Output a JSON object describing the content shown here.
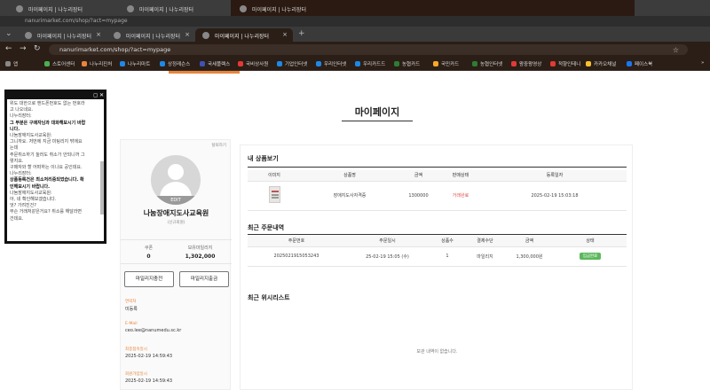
{
  "back_window": {
    "tabs": [
      "마이페이지 | 나누리장터",
      "마이페이지 | 나누리장터",
      "마이페이지 | 나누리장터"
    ],
    "url": "nanurimarket.com/shop/?act=mypage"
  },
  "browser": {
    "tabs": [
      {
        "label": "마이페이지 | 나누리장터"
      },
      {
        "label": "마이페이지 | 나누리장터"
      },
      {
        "label": "마이페이지 | 나누리장터"
      }
    ],
    "url": "nanurimarket.com/shop/?act=mypage",
    "bookmarks": [
      {
        "label": "앱",
        "color": "#888"
      },
      {
        "label": "스토어센터",
        "color": "#4caf50"
      },
      {
        "label": "나누리진처",
        "color": "#e8853c"
      },
      {
        "label": "나누리마트",
        "color": "#1e88e5"
      },
      {
        "label": "상정레슨스",
        "color": "#1e88e5"
      },
      {
        "label": "국세플렉스",
        "color": "#3f51b5"
      },
      {
        "label": "국비상사원",
        "color": "#e53935"
      },
      {
        "label": "기업인터넷",
        "color": "#1e88e5"
      },
      {
        "label": "우리인터넷",
        "color": "#1e88e5"
      },
      {
        "label": "우리카드드",
        "color": "#1e88e5"
      },
      {
        "label": "농협카드",
        "color": "#2e7d32"
      },
      {
        "label": "국민카드",
        "color": "#f9a825"
      },
      {
        "label": "농협인터넷",
        "color": "#2e7d32"
      },
      {
        "label": "왕중왕영상",
        "color": "#e53935"
      },
      {
        "label": "적향인테니",
        "color": "#e53935"
      },
      {
        "label": "카카오채널",
        "color": "#fbc02d"
      },
      {
        "label": "페이스북",
        "color": "#1877f2"
      }
    ]
  },
  "page": {
    "title": "마이페이지"
  },
  "popup": {
    "lines": [
      {
        "text": "위도 대한으로 핸드폰번호도 없는 번호라",
        "bold": false
      },
      {
        "text": "고 나오네요.",
        "bold": false
      },
      {
        "text": "나누리장터:",
        "bold": false
      },
      {
        "text": "그 부분은 구매자님과 대화해보시기 바랍",
        "bold": true
      },
      {
        "text": "니다.",
        "bold": true
      },
      {
        "text": "나눔장애지도사교육원:",
        "bold": false
      },
      {
        "text": "그니까요. 저번에 지금 미팅리지 밖에요",
        "bold": false
      },
      {
        "text": "는데",
        "bold": false
      },
      {
        "text": "주문취소하기 눌러도 취소가 안되니까 그",
        "bold": false
      },
      {
        "text": "렇지요.",
        "bold": false
      },
      {
        "text": "구매자와 할 어떠하는 이나요 공인데요.",
        "bold": false
      },
      {
        "text": "나누리장터:",
        "bold": false
      },
      {
        "text": "상품등록건은 최소처리중되었습니다. 확",
        "bold": true
      },
      {
        "text": "인해보시기 바랍니다.",
        "bold": true
      },
      {
        "text": "나눔장애지도사교육원:",
        "bold": false
      },
      {
        "text": "아, 네 확인해보겠습니다.",
        "bold": false
      },
      {
        "text": "엇? 가려진건?",
        "bold": false
      },
      {
        "text": "무슨 거래처같은거요? 취소를 해달라면",
        "bold": false
      },
      {
        "text": "건데요.",
        "bold": false
      }
    ]
  },
  "profile": {
    "top_link": "탈퇴하기",
    "edit_label": "EDIT",
    "name": "나눔장애지도사교육원",
    "grade": "(신규회원)",
    "coupon_label": "쿠폰",
    "coupon_value": "0",
    "mileage_label": "보유마일리지",
    "mileage_value": "1,302,000",
    "btn_charge": "마일리지충전",
    "btn_withdraw": "마일리지출금",
    "fields": [
      {
        "key": "연락처",
        "value": "미등록"
      },
      {
        "key": "E-Mail",
        "value": "ceo.lee@nanumedu.sc.kr"
      },
      {
        "key": "최종접속일시",
        "value": "2025-02-19 14:59:43"
      },
      {
        "key": "회원가입일시",
        "value": "2025-02-19 14:59:43"
      }
    ]
  },
  "products": {
    "title": "내 상품보기",
    "headers": [
      "이미지",
      "상품명",
      "금액",
      "판매상태",
      "등록일자"
    ],
    "rows": [
      {
        "name": "장애지도사자격증",
        "price": "1300000",
        "status": "거래완료",
        "date": "2025-02-19 15:03:18"
      }
    ]
  },
  "orders": {
    "title": "최근 주문내역",
    "headers": [
      "주문번호",
      "주문일시",
      "상품수",
      "결제수단",
      "금액",
      "상태"
    ],
    "rows": [
      {
        "no": "2025021915053243",
        "date": "25-02-19 15:05 (수)",
        "qty": "1",
        "method": "마일리지",
        "amount": "1,300,000원",
        "status": "입금완료"
      }
    ]
  },
  "wishlist": {
    "title": "최근 위시리스트",
    "empty": "보관 내역이 없습니다."
  }
}
